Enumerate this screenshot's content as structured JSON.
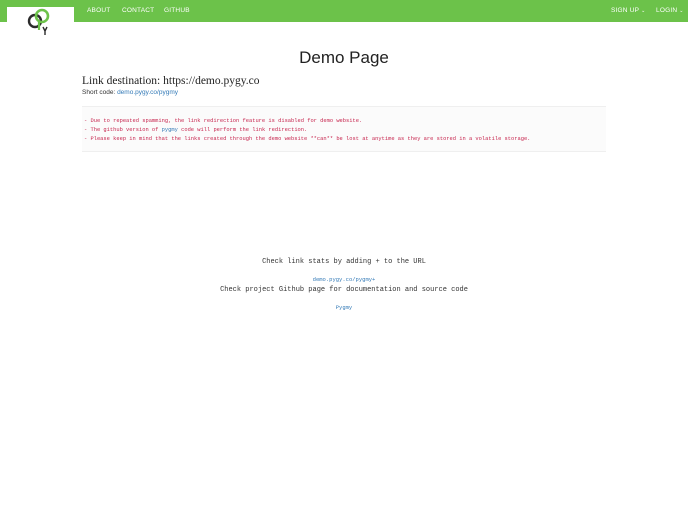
{
  "navbar": {
    "color": "#6cc24a",
    "logo_icon": "pygy-logo-icon",
    "links": [
      "ABOUT",
      "CONTACT",
      "GITHUB"
    ],
    "signup": "SIGN UP",
    "login": "LOGIN"
  },
  "title": "Demo Page",
  "link_destination": "Link destination: https://demo.pygy.co",
  "short_code": {
    "label": "Short code:",
    "link": "demo.pygy.co/pygmy"
  },
  "warnings": {
    "line1": "- Due to repeated spamming, the link redirection feature is disabled for demo website.",
    "line2_pre": "- The github version of",
    "line2_link": "pygmy",
    "line2_post": "code will perform the link redirection.",
    "line3": "- Please keep in mind that the links created through the demo website **can** be lost at anytime as they are stored in a volatile storage."
  },
  "stats": {
    "text": "Check link stats by adding + to the URL",
    "link": "demo.pygy.co/pygmy+"
  },
  "github": {
    "text": "Check project Github page for documentation and source code",
    "link": "Pygmy"
  }
}
